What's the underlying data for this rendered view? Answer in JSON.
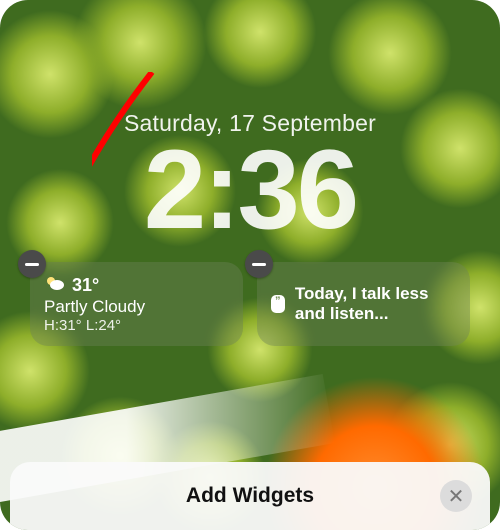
{
  "date": "Saturday, 17 September",
  "time": "2:36",
  "widgets": {
    "weather": {
      "icon": "weather-partly-cloudy-icon",
      "temp": "31°",
      "condition": "Partly Cloudy",
      "hilo": "H:31° L:24°"
    },
    "message": {
      "icon": "speech-bubble-icon",
      "text": "Today, I talk less and listen..."
    }
  },
  "bottomBar": {
    "label": "Add Widgets"
  },
  "colors": {
    "arrow": "#ff0000",
    "widgetBg": "rgba(110,130,90,0.40)"
  }
}
